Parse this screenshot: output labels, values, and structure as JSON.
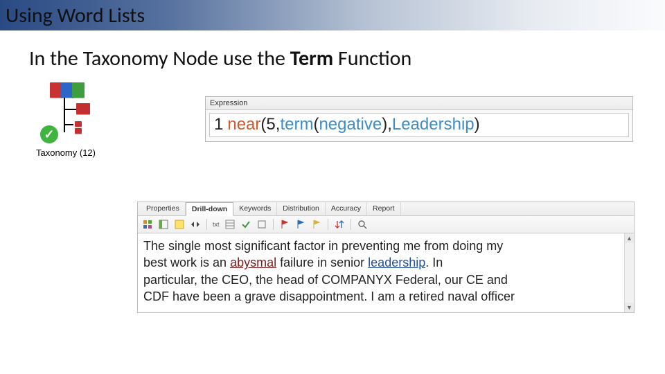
{
  "title_bar": "Using Word Lists",
  "subtitle": {
    "pre": "In the Taxonomy Node use the ",
    "bold": "Term",
    "post": " Function"
  },
  "taxonomy": {
    "label": "Taxonomy (12)"
  },
  "expression": {
    "header": "Expression",
    "line_no": "1",
    "near": "near",
    "open1": "(",
    "five": "5",
    "comma1": ", ",
    "term": "term",
    "open2": "(",
    "neg": "negative",
    "close2": ")",
    "comma2": " , ",
    "lead": "Leadership",
    "close1": ")"
  },
  "drill": {
    "tabs": [
      "Properties",
      "Drill-down",
      "Keywords",
      "Distribution",
      "Accuracy",
      "Report"
    ],
    "active_tab_index": 1,
    "toolbar_icons": [
      "grid1",
      "grid2",
      "grid-yellow",
      "arrows-lr",
      "label-tag",
      "grid3",
      "check",
      "checkbox",
      "flag-red",
      "flag-blue",
      "flag-yellow",
      "sort-rows",
      "magnify"
    ],
    "body": {
      "t1": "The single most significant factor in preventing me from doing my ",
      "t2": "best work is an ",
      "hl1": "abysmal",
      "t3": " failure in senior ",
      "hl2": "leadership",
      "t4": ". In ",
      "t5": "particular, the CEO, the head of COMPANYX Federal, our CE and ",
      "t6": "CDF have been a grave disappointment. I am a retired naval officer"
    }
  }
}
